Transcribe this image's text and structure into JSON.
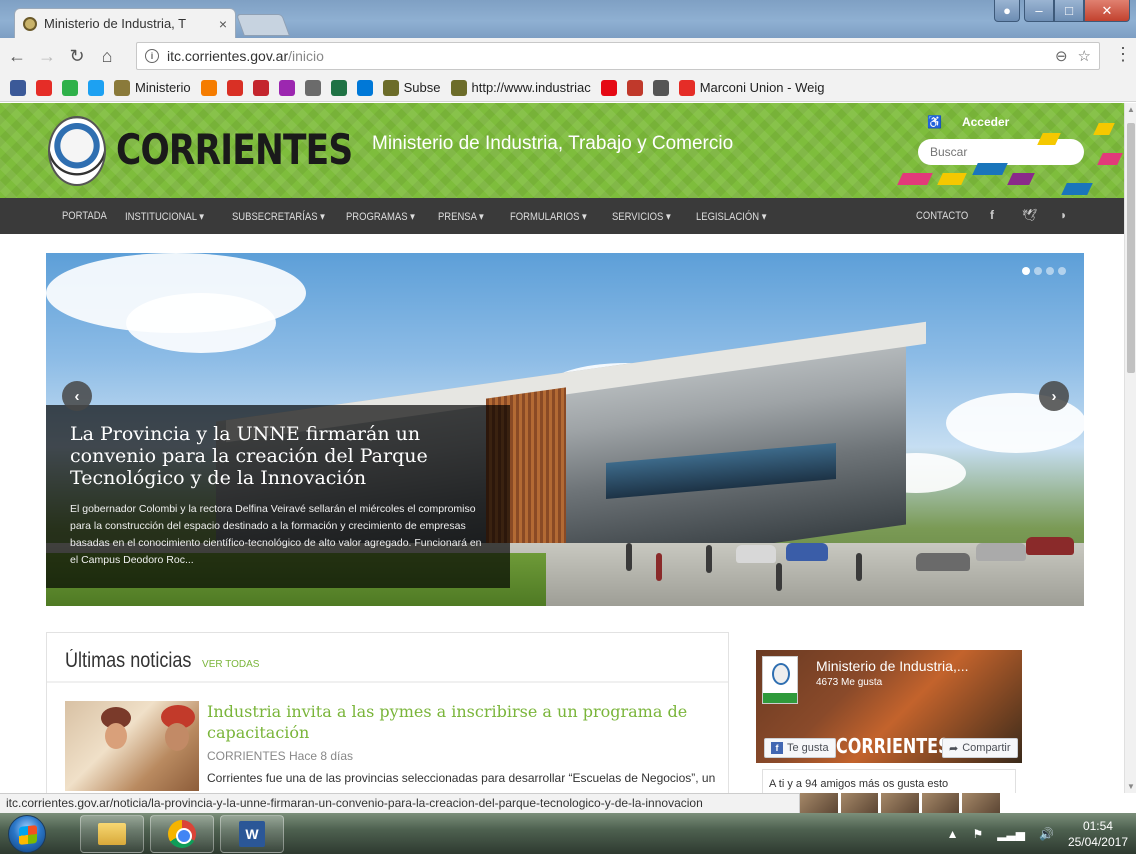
{
  "browser": {
    "tab_title": "Ministerio de Industria, T",
    "tab_close": "×",
    "window_buttons": {
      "minimize": "–",
      "maximize": "□",
      "close": "✕"
    },
    "url_host": "itc.corrientes.gov.ar",
    "url_path": "/inicio",
    "bookmarks": [
      {
        "icon": "facebook-icon",
        "label": ""
      },
      {
        "icon": "youtube-icon",
        "label": ""
      },
      {
        "icon": "green-app-icon",
        "label": ""
      },
      {
        "icon": "twitter-icon",
        "label": ""
      },
      {
        "icon": "ministerio-icon",
        "label": "Ministerio"
      },
      {
        "icon": "orange-circle-icon",
        "label": ""
      },
      {
        "icon": "gmail-icon",
        "label": ""
      },
      {
        "icon": "red-app-icon",
        "label": ""
      },
      {
        "icon": "colorful-app-icon",
        "label": ""
      },
      {
        "icon": "seal-icon",
        "label": ""
      },
      {
        "icon": "excel-icon",
        "label": ""
      },
      {
        "icon": "windows-icon",
        "label": ""
      },
      {
        "icon": "subse-icon",
        "label": "Subse"
      },
      {
        "icon": "industria-icon",
        "label": "http://www.industriac"
      },
      {
        "icon": "netflix-icon",
        "label": ""
      },
      {
        "icon": "gear-badge-icon",
        "label": ""
      },
      {
        "icon": "eye-badge-icon",
        "label": ""
      },
      {
        "icon": "youtube-icon",
        "label": "Marconi Union - Weig"
      }
    ]
  },
  "site": {
    "brand": "CORRIENTES",
    "ministry": "Ministerio de Industria, Trabajo y Comercio",
    "login": "Acceder",
    "search_placeholder": "Buscar",
    "nav": [
      "PORTADA",
      "INSTITUCIONAL ▾",
      "SUBSECRETARÍAS ▾",
      "PROGRAMAS ▾",
      "PRENSA ▾",
      "FORMULARIOS ▾",
      "SERVICIOS ▾",
      "LEGISLACIÓN ▾",
      "CONTACTO"
    ],
    "social": {
      "facebook": "f",
      "twitter": "🐦",
      "rss": "⟟"
    }
  },
  "slider": {
    "headline": "La Provincia y la UNNE firmarán un convenio para la creación del Parque Tecnológico y de la Innovación",
    "summary": "El gobernador Colombi y la rectora Delfina Veiravé sellarán el miércoles el compromiso para la construcción del espacio destinado a la formación y crecimiento de empresas basadas en el conocimiento científico-tecnológico de alto valor agregado. Funcionará en el Campus Deodoro Roc...",
    "prev": "‹",
    "next": "›",
    "slide_count": 4,
    "active_slide": 1
  },
  "news": {
    "heading": "Últimas noticias",
    "see_all": "VER TODAS",
    "items": [
      {
        "title": "Industria invita a las pymes a inscribirse a un programa de capacitación",
        "meta": "CORRIENTES Hace 8 días",
        "excerpt": "Corrientes fue una de las provincias seleccionadas para desarrollar “Escuelas de Negocios”, un"
      }
    ]
  },
  "facebook": {
    "page_name": "Ministerio de Industria,...",
    "likes": "4673 Me gusta",
    "brand": "CORRIENTES",
    "like_button": "Te gusta",
    "share_button": "Compartir",
    "friends": "A ti y a 94 amigos más os gusta esto"
  },
  "status_url": "itc.corrientes.gov.ar/noticia/la-provincia-y-la-unne-firmaran-un-convenio-para-la-creacion-del-parque-tecnologico-y-de-la-innovacion",
  "taskbar": {
    "time": "01:54",
    "date": "25/04/2017"
  },
  "colors": {
    "brand_green": "#7ebd3c",
    "nav_dark": "#3a3a3a",
    "link_green": "#7ab53a"
  }
}
